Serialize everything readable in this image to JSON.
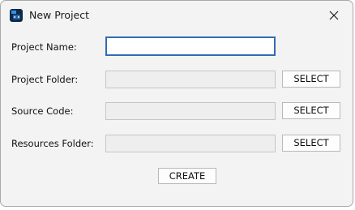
{
  "window": {
    "title": "New Project"
  },
  "icons": {
    "app": "code-app-icon",
    "close": "close-icon"
  },
  "form": {
    "project_name": {
      "label": "Project Name:",
      "value": ""
    },
    "project_folder": {
      "label": "Project Folder:",
      "value": "",
      "button_label": "SELECT"
    },
    "source_code": {
      "label": "Source Code:",
      "value": "",
      "button_label": "SELECT"
    },
    "resources_folder": {
      "label": "Resources Folder:",
      "value": "",
      "button_label": "SELECT"
    }
  },
  "actions": {
    "create_label": "CREATE"
  },
  "colors": {
    "focus_border": "#2f6db3",
    "app_icon_bg": "#0e2a47"
  }
}
